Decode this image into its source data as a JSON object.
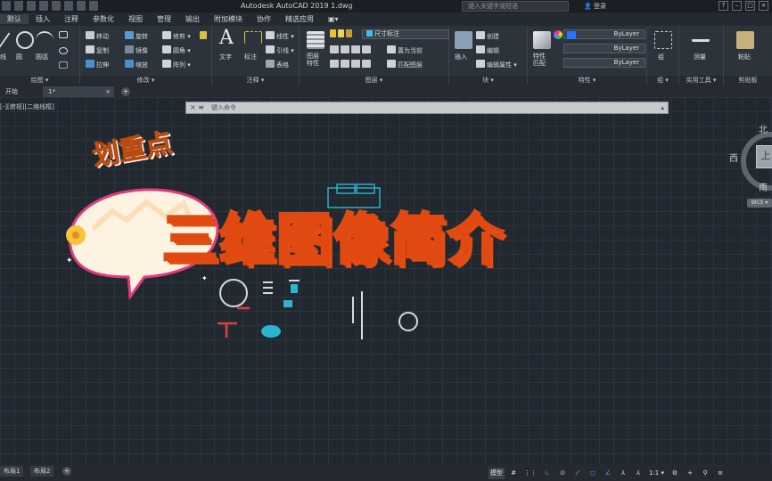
{
  "titlebar": {
    "app_title": "Autodesk AutoCAD 2019    1.dwg",
    "search_placeholder": "键入关键字或短语",
    "user_label": "登录",
    "help": "?"
  },
  "menu": {
    "items": [
      "默认",
      "插入",
      "注释",
      "参数化",
      "视图",
      "管理",
      "输出",
      "附加模块",
      "协作",
      "精选应用",
      "▣▾"
    ]
  },
  "ribbon": {
    "draw": {
      "title": "绘图 ▾",
      "items": [
        "线",
        "圆",
        "圆弧"
      ]
    },
    "modify": {
      "title": "修改 ▾",
      "items": [
        "移动",
        "旋转",
        "修剪 ▾",
        "复制",
        "镜像",
        "圆角 ▾",
        "拉伸",
        "缩放",
        "阵列 ▾"
      ]
    },
    "annotation": {
      "title": "注释 ▾",
      "items": [
        "文字",
        "标注",
        "线性 ▾",
        "引线 ▾",
        "表格"
      ]
    },
    "layers": {
      "title": "图层 ▾",
      "current": "尺寸标注",
      "props_label": "图层\n特性",
      "items": [
        "置为当前",
        "匹配图层"
      ]
    },
    "block": {
      "title": "块 ▾",
      "items": [
        "插入",
        "创建",
        "编辑",
        "编辑属性 ▾"
      ]
    },
    "properties": {
      "title": "特性 ▾",
      "match_label": "特性\n匹配",
      "values": [
        "ByLayer",
        "ByLayer",
        "ByLayer"
      ]
    },
    "groups": {
      "title": "组 ▾",
      "label": "组"
    },
    "utilities": {
      "title": "实用工具 ▾",
      "label": "测量"
    },
    "clipboard": {
      "title": "剪贴板",
      "label": "粘贴"
    }
  },
  "file_tabs": {
    "start": "开始",
    "current": "1*"
  },
  "viewport": {
    "label": "[-][俯视][二维线框]",
    "command_placeholder": "键入命令",
    "compass": {
      "north": "北",
      "west": "西",
      "south": "南",
      "face": "上",
      "wcs": "WCS ▾"
    }
  },
  "overlay": {
    "bubble_text": "划重点",
    "headline": "三维图像简介"
  },
  "layout_tabs": [
    "布局1",
    "布局2"
  ],
  "statusbar": {
    "model": "模型",
    "scale": "1:1 ▾"
  }
}
